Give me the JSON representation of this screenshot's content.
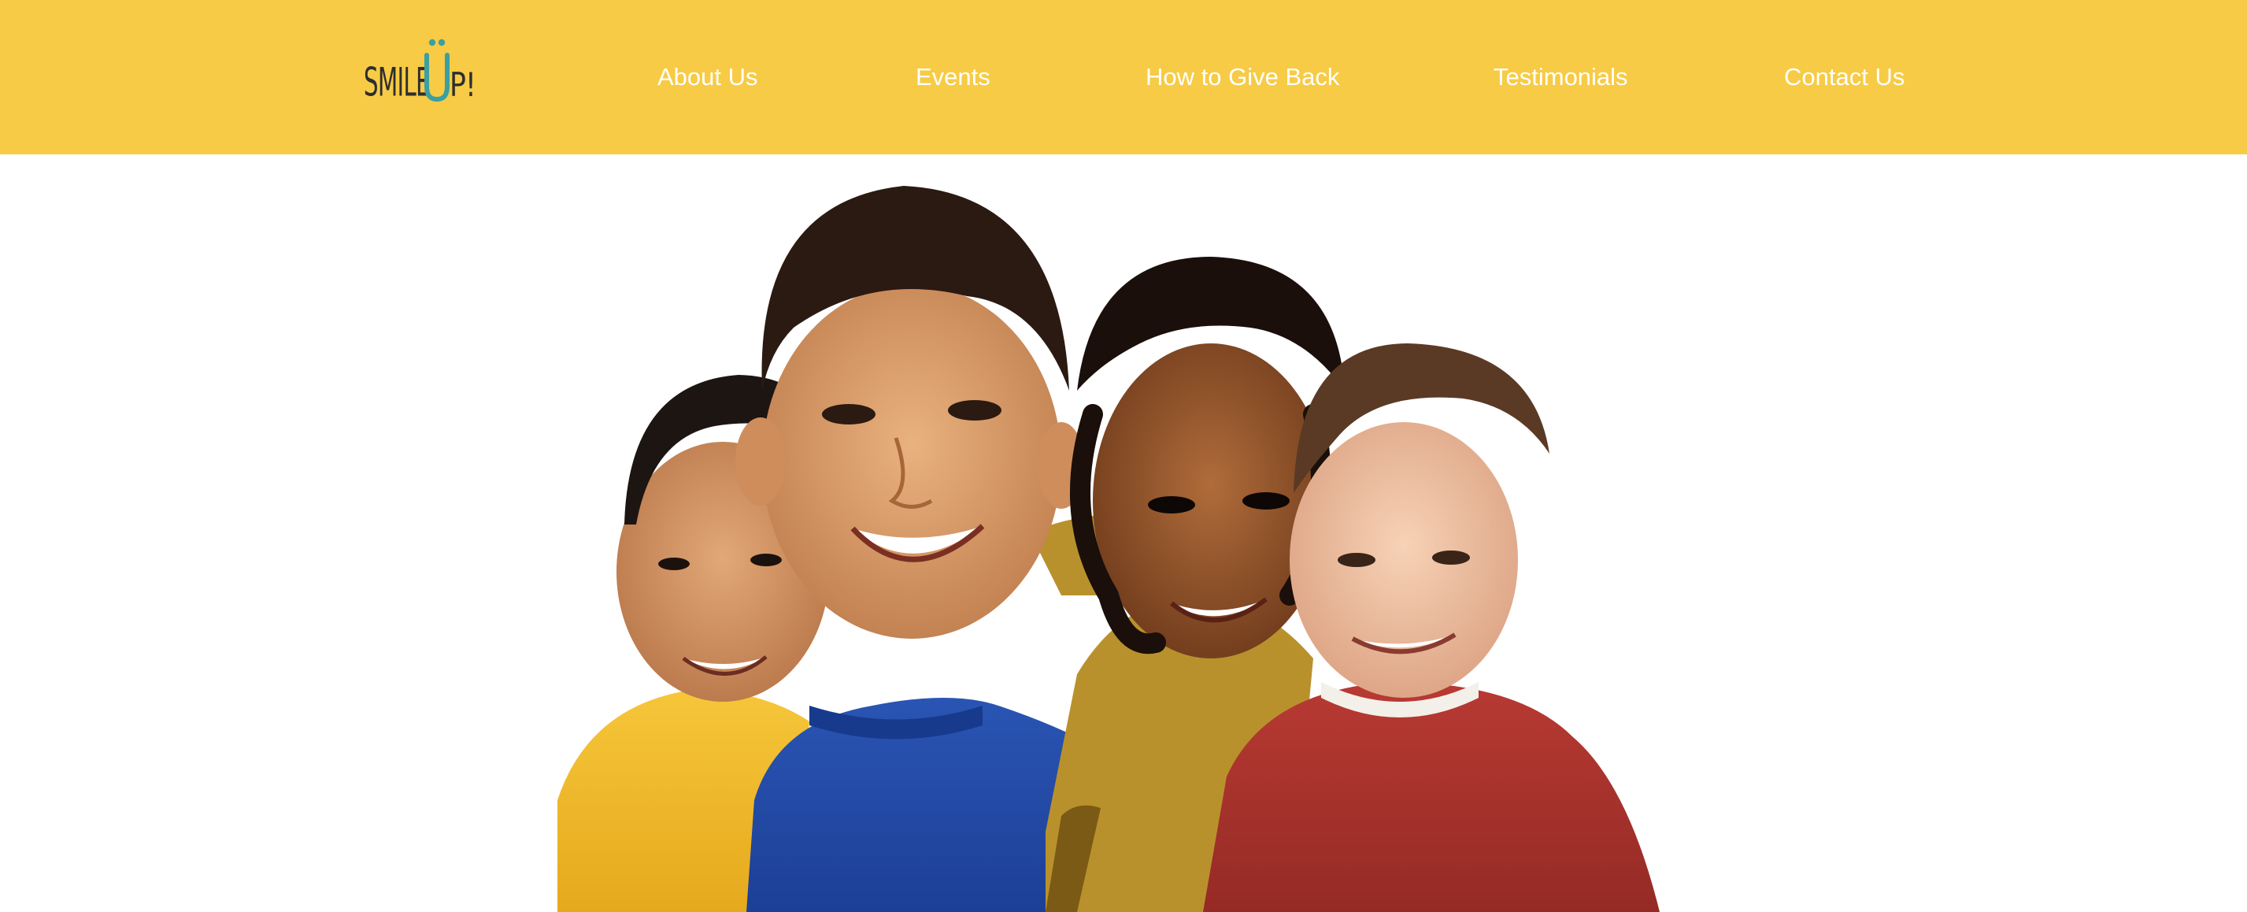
{
  "brand": {
    "logo_text": "SMILEÜP!",
    "logo_parts": {
      "left": "SMILE",
      "accent": "U",
      "right": "P!"
    }
  },
  "nav": {
    "items": [
      {
        "label": "About Us"
      },
      {
        "label": "Events"
      },
      {
        "label": "How to Give Back"
      },
      {
        "label": "Testimonials"
      },
      {
        "label": "Contact Us"
      }
    ]
  },
  "hero": {
    "image": "photo of four smiling children in yellow, blue and red shirts"
  },
  "colors": {
    "header_bg": "#f7cb45",
    "nav_text": "#ffffff",
    "logo_dark": "#2e2e2e",
    "logo_accent": "#3aa0a2",
    "page_bg": "#ffffff"
  }
}
